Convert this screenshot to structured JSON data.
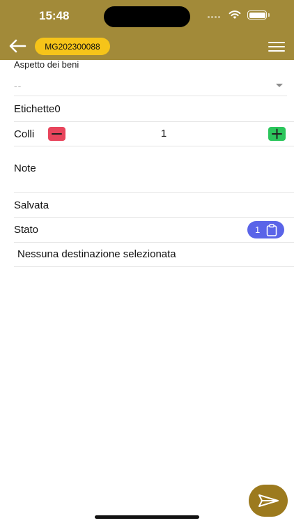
{
  "status_bar": {
    "time": "15:48"
  },
  "header": {
    "document_code": "MG202300088"
  },
  "form": {
    "aspetto": {
      "label": "Aspetto dei beni",
      "value": "--"
    },
    "etichette": {
      "label": "Etichette",
      "value": "0"
    },
    "colli": {
      "label": "Colli",
      "value": "1"
    },
    "note": {
      "label": "Note"
    },
    "salvata": {
      "label": "Salvata"
    },
    "stato": {
      "label": "Stato",
      "count": "1"
    },
    "destinazione": {
      "text": "Nessuna destinazione selezionata"
    }
  },
  "colors": {
    "header_bg": "#a28a39",
    "badge_bg": "#f6c419",
    "minus": "#e8455c",
    "plus": "#2cc65c",
    "stato_pill": "#5a64e8",
    "fab": "#9c7a1e"
  },
  "icons": {
    "back": "arrow-left-icon",
    "menu": "hamburger-menu-icon",
    "minus": "minus-icon",
    "plus": "plus-icon",
    "stato": "clipboard-icon",
    "send": "send-icon"
  }
}
